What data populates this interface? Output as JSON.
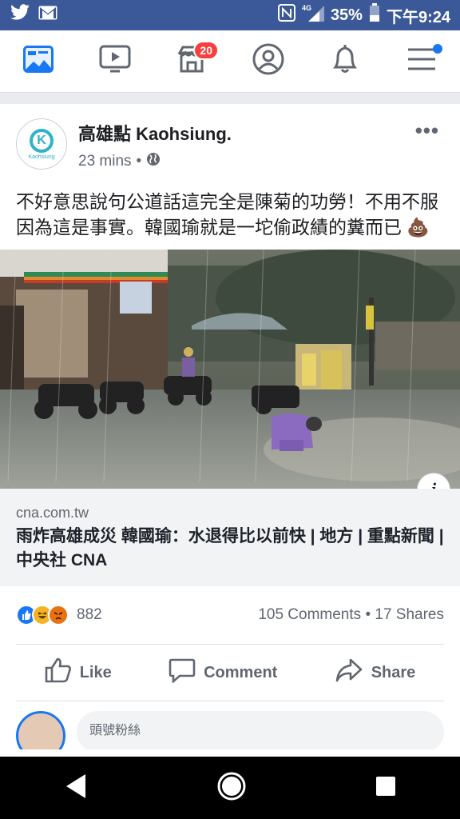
{
  "status_bar": {
    "network": "4G",
    "battery": "35%",
    "time": "下午9:24"
  },
  "nav": {
    "marketplace_badge": "20"
  },
  "post": {
    "page_name": "高雄點 Kaohsiung.",
    "avatar_text": "Kaohsiung",
    "timestamp": "23 mins",
    "separator": "•",
    "body": "不好意思說句公道話這完全是陳菊的功勞！不用不服因為這是事實。韓國瑜就是一坨偷政績的糞而已 💩",
    "info_glyph": "i",
    "link": {
      "domain": "cna.com.tw",
      "title": "雨炸高雄成災 韓國瑜：水退得比以前快 | 地方 | 重點新聞 | 中央社 CNA"
    },
    "reactions": {
      "count": "882",
      "comments": "105 Comments",
      "shares": "17 Shares",
      "dot": "•"
    },
    "actions": {
      "like": "Like",
      "comment": "Comment",
      "share": "Share"
    },
    "comment_box": {
      "placeholder": "頭號粉絲"
    }
  },
  "colors": {
    "brand": "#3b5998",
    "badge": "#fa3e3e",
    "link_bg": "#f2f3f5",
    "like_blue": "#1877f2"
  },
  "icons": [
    "twitter-icon",
    "gmail-icon",
    "nfc-icon",
    "signal-icon",
    "battery-icon",
    "news-feed-icon",
    "watch-icon",
    "marketplace-icon",
    "profile-icon",
    "bell-icon",
    "menu-icon",
    "globe-icon",
    "more-icon",
    "info-icon",
    "like-icon",
    "comment-icon",
    "share-icon",
    "back-icon",
    "home-icon",
    "recents-icon"
  ]
}
